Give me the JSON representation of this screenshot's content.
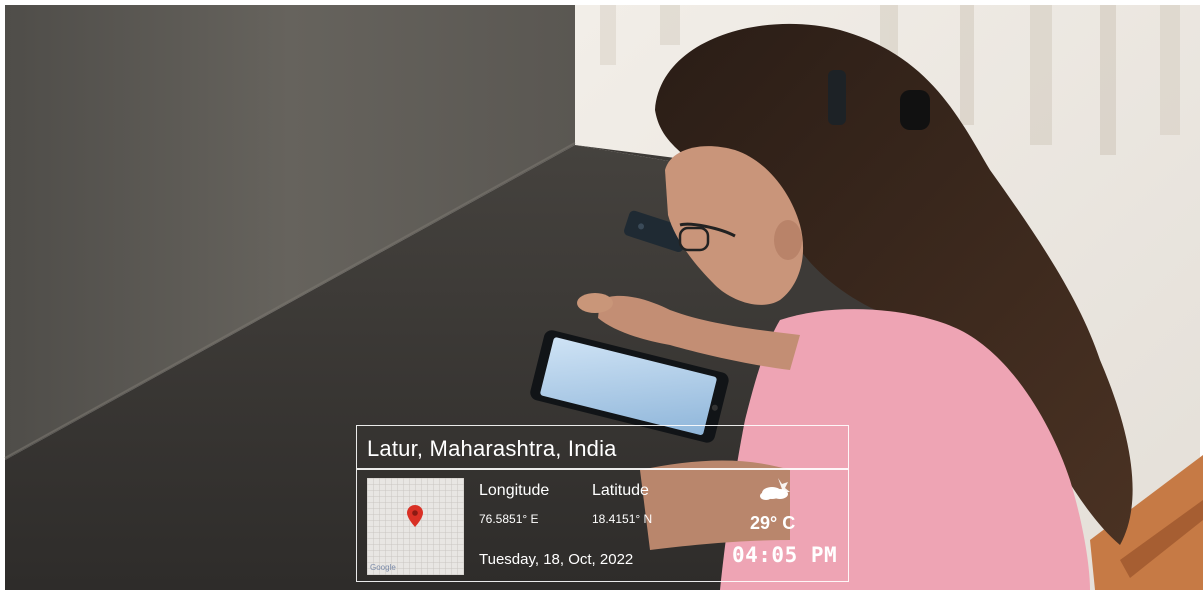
{
  "overlay": {
    "location": "Latur, Maharashtra, India",
    "longitude_label": "Longitude",
    "longitude_value": "76.5851° E",
    "latitude_label": "Latitude",
    "latitude_value": "18.4151° N",
    "date": "Tuesday, 18, Oct, 2022",
    "temperature": "29° C",
    "time": "04:05 PM",
    "map_brand": "Google",
    "map_pin_icon": "map-pin-icon",
    "weather_icon": "partly-cloudy-icon"
  },
  "colors": {
    "overlay_text": "#ffffff",
    "map_pin": "#d93025",
    "shirt": "#eea4b4",
    "table": "#3a3734",
    "wall_panel": "#5e5b55"
  }
}
